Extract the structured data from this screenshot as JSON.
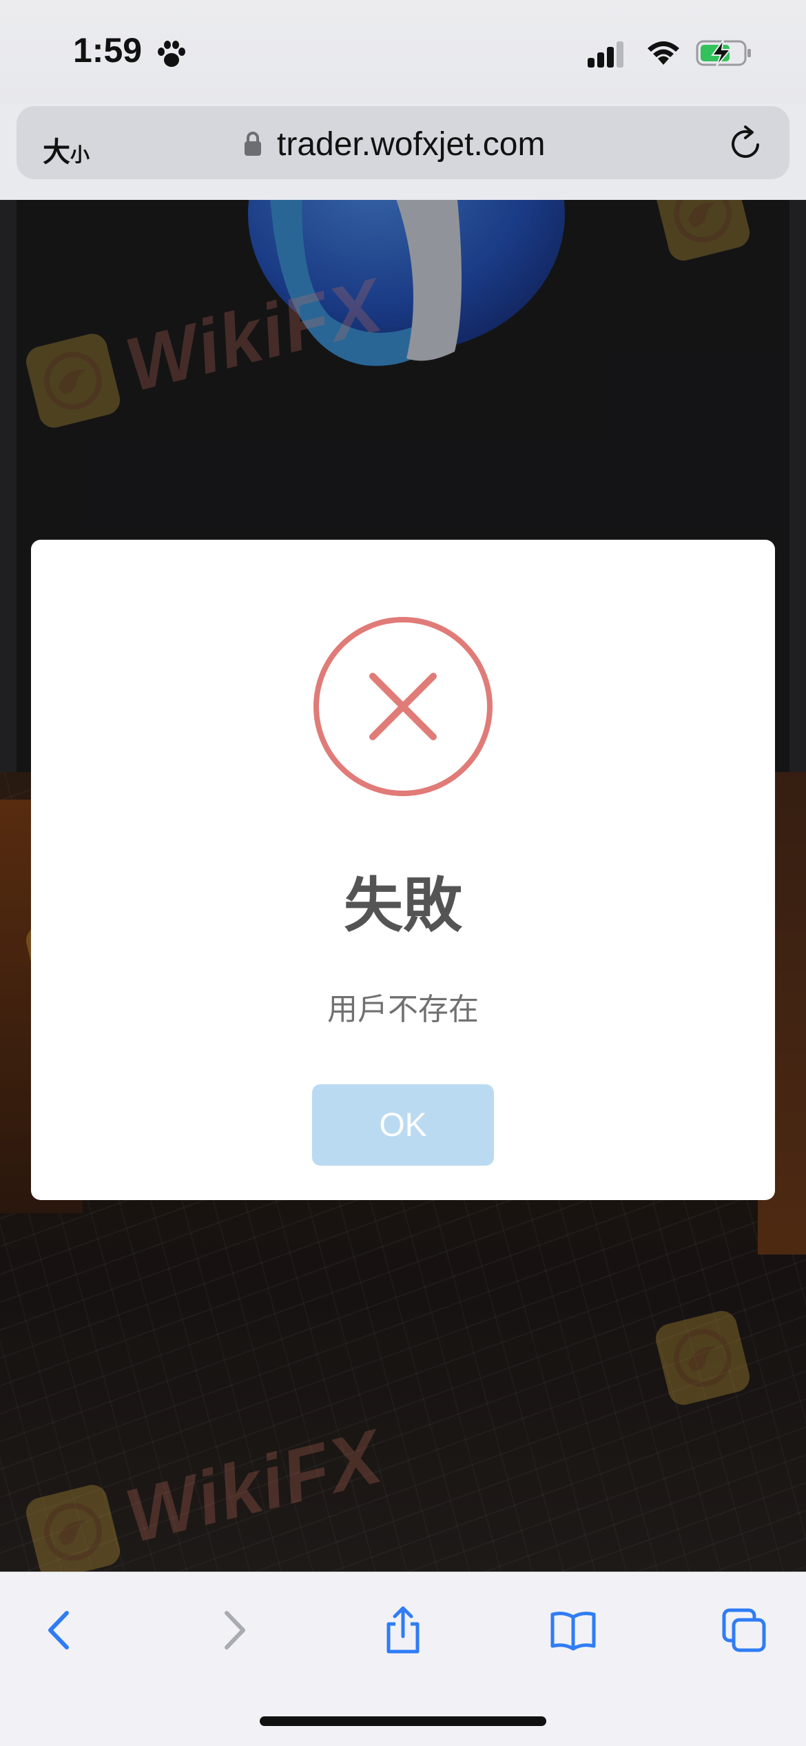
{
  "status_bar": {
    "time": "1:59"
  },
  "address_bar": {
    "text_size_large": "大",
    "text_size_small": "小",
    "url": "trader.wofxjet.com"
  },
  "watermark": {
    "text": "WikiFX"
  },
  "dialog": {
    "title": "失敗",
    "message": "用戶不存在",
    "ok_label": "OK"
  },
  "colors": {
    "error_red": "#e07b78",
    "ok_button_bg": "#badaf2",
    "toolbar_blue": "#2f7cf6"
  },
  "toolbar": {
    "items": [
      "back-icon",
      "forward-icon",
      "share-icon",
      "bookmarks-icon",
      "tabs-icon"
    ]
  }
}
